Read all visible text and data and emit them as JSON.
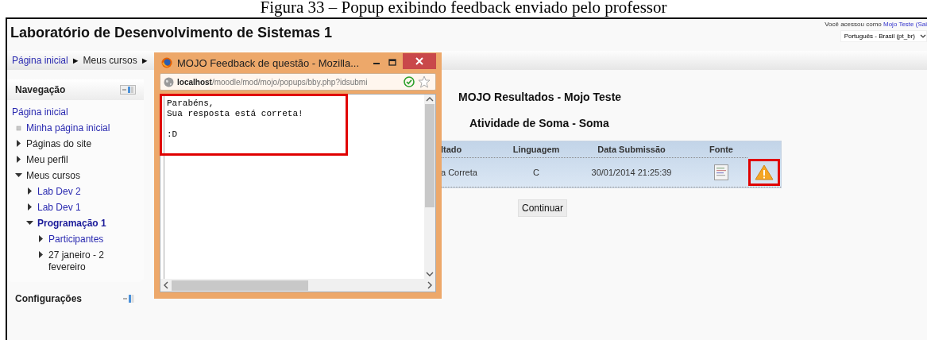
{
  "caption": "Figura 33 – Popup exibindo feedback enviado pelo professor",
  "header": {
    "site_title": "Laboratório de Desenvolvimento de Sistemas 1",
    "login_prefix": "Você acessou como",
    "login_user": "Mojo Teste",
    "login_suffix": "(Sai",
    "language": "Português - Brasil (pt_br)"
  },
  "breadcrumb": [
    {
      "label": "Página inicial",
      "link": true,
      "separator": "►"
    },
    {
      "label": "Meus cursos",
      "link": false,
      "separator": "►"
    }
  ],
  "navigation": {
    "title": "Navegação",
    "items": [
      {
        "label": "Página inicial",
        "kind": "root",
        "link": true,
        "selected": false
      },
      {
        "label": "Minha página inicial",
        "kind": "page",
        "link": true,
        "selected": false
      },
      {
        "label": "Páginas do site",
        "kind": "branch",
        "expanded": false,
        "link": false,
        "selected": false
      },
      {
        "label": "Meu perfil",
        "kind": "branch",
        "expanded": false,
        "link": false,
        "selected": false
      },
      {
        "label": "Meus cursos",
        "kind": "branch",
        "expanded": true,
        "link": false,
        "selected": false,
        "children": [
          {
            "label": "Lab Dev 2",
            "kind": "branch",
            "expanded": false,
            "link": true,
            "selected": false
          },
          {
            "label": "Lab Dev 1",
            "kind": "branch",
            "expanded": false,
            "link": true,
            "selected": false
          },
          {
            "label": "Programação 1",
            "kind": "branch",
            "expanded": true,
            "link": true,
            "selected": true,
            "children": [
              {
                "label": "Participantes",
                "kind": "branch",
                "expanded": false,
                "link": true,
                "selected": false
              },
              {
                "label": "27 janeiro - 2 fevereiro",
                "kind": "branch",
                "expanded": false,
                "link": false,
                "selected": false
              }
            ]
          }
        ]
      }
    ]
  },
  "settings": {
    "title": "Configurações"
  },
  "popup": {
    "title": "MOJO Feedback de questão - Mozilla...",
    "url_host": "localhost",
    "url_path": "/moodle/mod/mojo/popups/bby.php?idsubmi",
    "feedback": "Parabéns,\nSua resposta está correta!\n\n:D",
    "highlighted": true
  },
  "results": {
    "title": "MOJO Resultados - Mojo Teste",
    "activity": "Atividade de Soma - Soma",
    "columns": [
      "ltado",
      "Linguagem",
      "Data Submissão",
      "Fonte"
    ],
    "rows": [
      {
        "cells": [
          "a Correta",
          "C",
          "30/01/2014 21:25:39"
        ],
        "warning_highlighted": true
      }
    ]
  },
  "continue_button": "Continuar"
}
